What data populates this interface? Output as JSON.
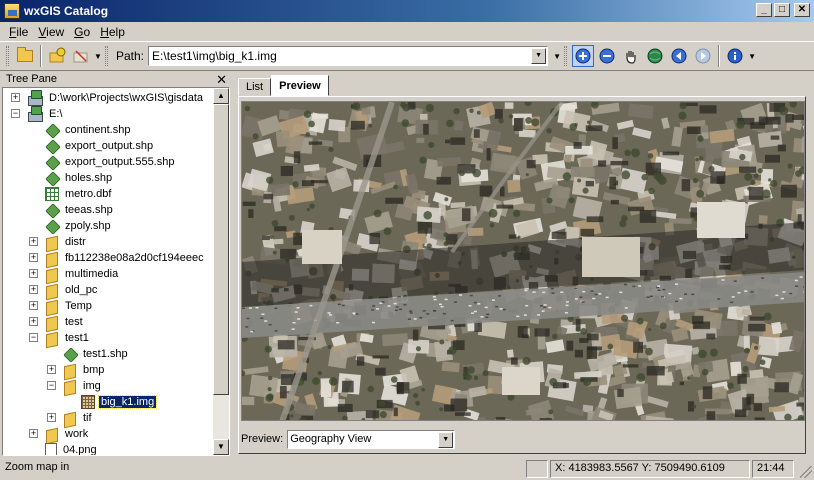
{
  "window": {
    "title": "wxGIS Catalog"
  },
  "menu": [
    {
      "label": "File",
      "accel": "F",
      "rest": "ile"
    },
    {
      "label": "View",
      "accel": "V",
      "rest": "iew"
    },
    {
      "label": "Go",
      "accel": "G",
      "rest": "o"
    },
    {
      "label": "Help",
      "accel": "H",
      "rest": "elp"
    }
  ],
  "toolbar": {
    "path_label": "Path:",
    "path_value": "E:\\test1\\img\\big_k1.img"
  },
  "tree_pane": {
    "title": "Tree Pane",
    "items": [
      {
        "label": "D:\\work\\Projects\\wxGIS\\gisdata",
        "icon": "drive-icon",
        "expander": "+"
      },
      {
        "label": "E:\\",
        "icon": "drive-icon",
        "expander": "-"
      },
      {
        "label": "continent.shp",
        "icon": "shapefile-icon"
      },
      {
        "label": "export_output.shp",
        "icon": "shapefile-icon"
      },
      {
        "label": "export_output.555.shp",
        "icon": "shapefile-icon"
      },
      {
        "label": "holes.shp",
        "icon": "shapefile-icon"
      },
      {
        "label": "metro.dbf",
        "icon": "table-icon"
      },
      {
        "label": "teeas.shp",
        "icon": "shapefile-icon"
      },
      {
        "label": "zpoly.shp",
        "icon": "shapefile-icon"
      },
      {
        "label": "distr",
        "icon": "folder-icon",
        "expander": "+"
      },
      {
        "label": "fb112238e08a2d0cf194eeec",
        "icon": "folder-icon",
        "expander": "+"
      },
      {
        "label": "multimedia",
        "icon": "folder-icon",
        "expander": "+"
      },
      {
        "label": "old_pc",
        "icon": "folder-icon",
        "expander": "+"
      },
      {
        "label": "Temp",
        "icon": "folder-icon",
        "expander": "+"
      },
      {
        "label": "test",
        "icon": "folder-icon",
        "expander": "+"
      },
      {
        "label": "test1",
        "icon": "folder-icon",
        "expander": "-"
      },
      {
        "label": "test1.shp",
        "icon": "shapefile-icon"
      },
      {
        "label": "bmp",
        "icon": "folder-icon",
        "expander": "+"
      },
      {
        "label": "img",
        "icon": "folder-icon",
        "expander": "-"
      },
      {
        "label": "big_k1.img",
        "icon": "raster-icon",
        "selected": true
      },
      {
        "label": "tif",
        "icon": "folder-icon",
        "expander": "+"
      },
      {
        "label": "work",
        "icon": "folder-icon",
        "expander": "+"
      },
      {
        "label": "04.png",
        "icon": "image-file-icon"
      }
    ]
  },
  "tabs": [
    {
      "label": "List",
      "active": false
    },
    {
      "label": "Preview",
      "active": true
    }
  ],
  "preview": {
    "label": "Preview:",
    "mode": "Geography View"
  },
  "status": {
    "message": "Zoom map in",
    "coords": "X: 4183983.5567  Y: 7509490.6109",
    "time": "21:44"
  },
  "colors": {
    "title_bar": "#0a246a",
    "selection": "#0a246a",
    "window_face": "#d4d0c8"
  }
}
